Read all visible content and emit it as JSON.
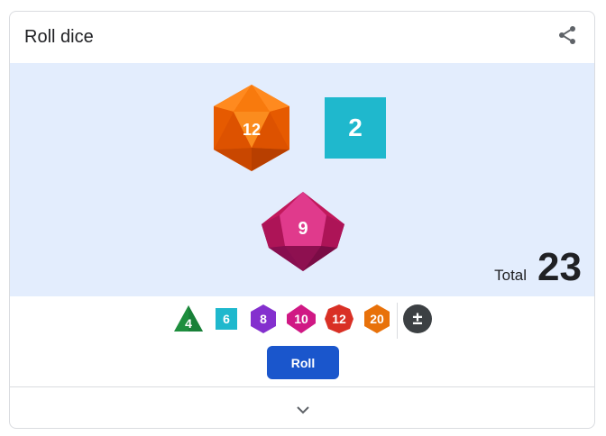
{
  "header": {
    "title": "Roll dice",
    "share_icon": "share-icon"
  },
  "rolled_dice": [
    {
      "type": "d20",
      "value": "12",
      "color": "#f45d0a"
    },
    {
      "type": "d6",
      "value": "2",
      "color": "#1fb8cd"
    },
    {
      "type": "d10",
      "value": "9",
      "color": "#c2185b"
    }
  ],
  "total": {
    "label": "Total",
    "value": "23"
  },
  "dice_picker": [
    {
      "type": "d4",
      "label": "4",
      "color": "#1e8e3e"
    },
    {
      "type": "d6",
      "label": "6",
      "color": "#1fb8cd"
    },
    {
      "type": "d8",
      "label": "8",
      "color": "#8430ce"
    },
    {
      "type": "d10",
      "label": "10",
      "color": "#d01884"
    },
    {
      "type": "d12",
      "label": "12",
      "color": "#d93025"
    },
    {
      "type": "d20",
      "label": "20",
      "color": "#e8710a"
    },
    {
      "type": "modifier",
      "label": "±",
      "color": "#3c4043"
    }
  ],
  "roll_button": {
    "label": "Roll",
    "color": "#1a56cc"
  },
  "expand_icon": "chevron-down-icon"
}
